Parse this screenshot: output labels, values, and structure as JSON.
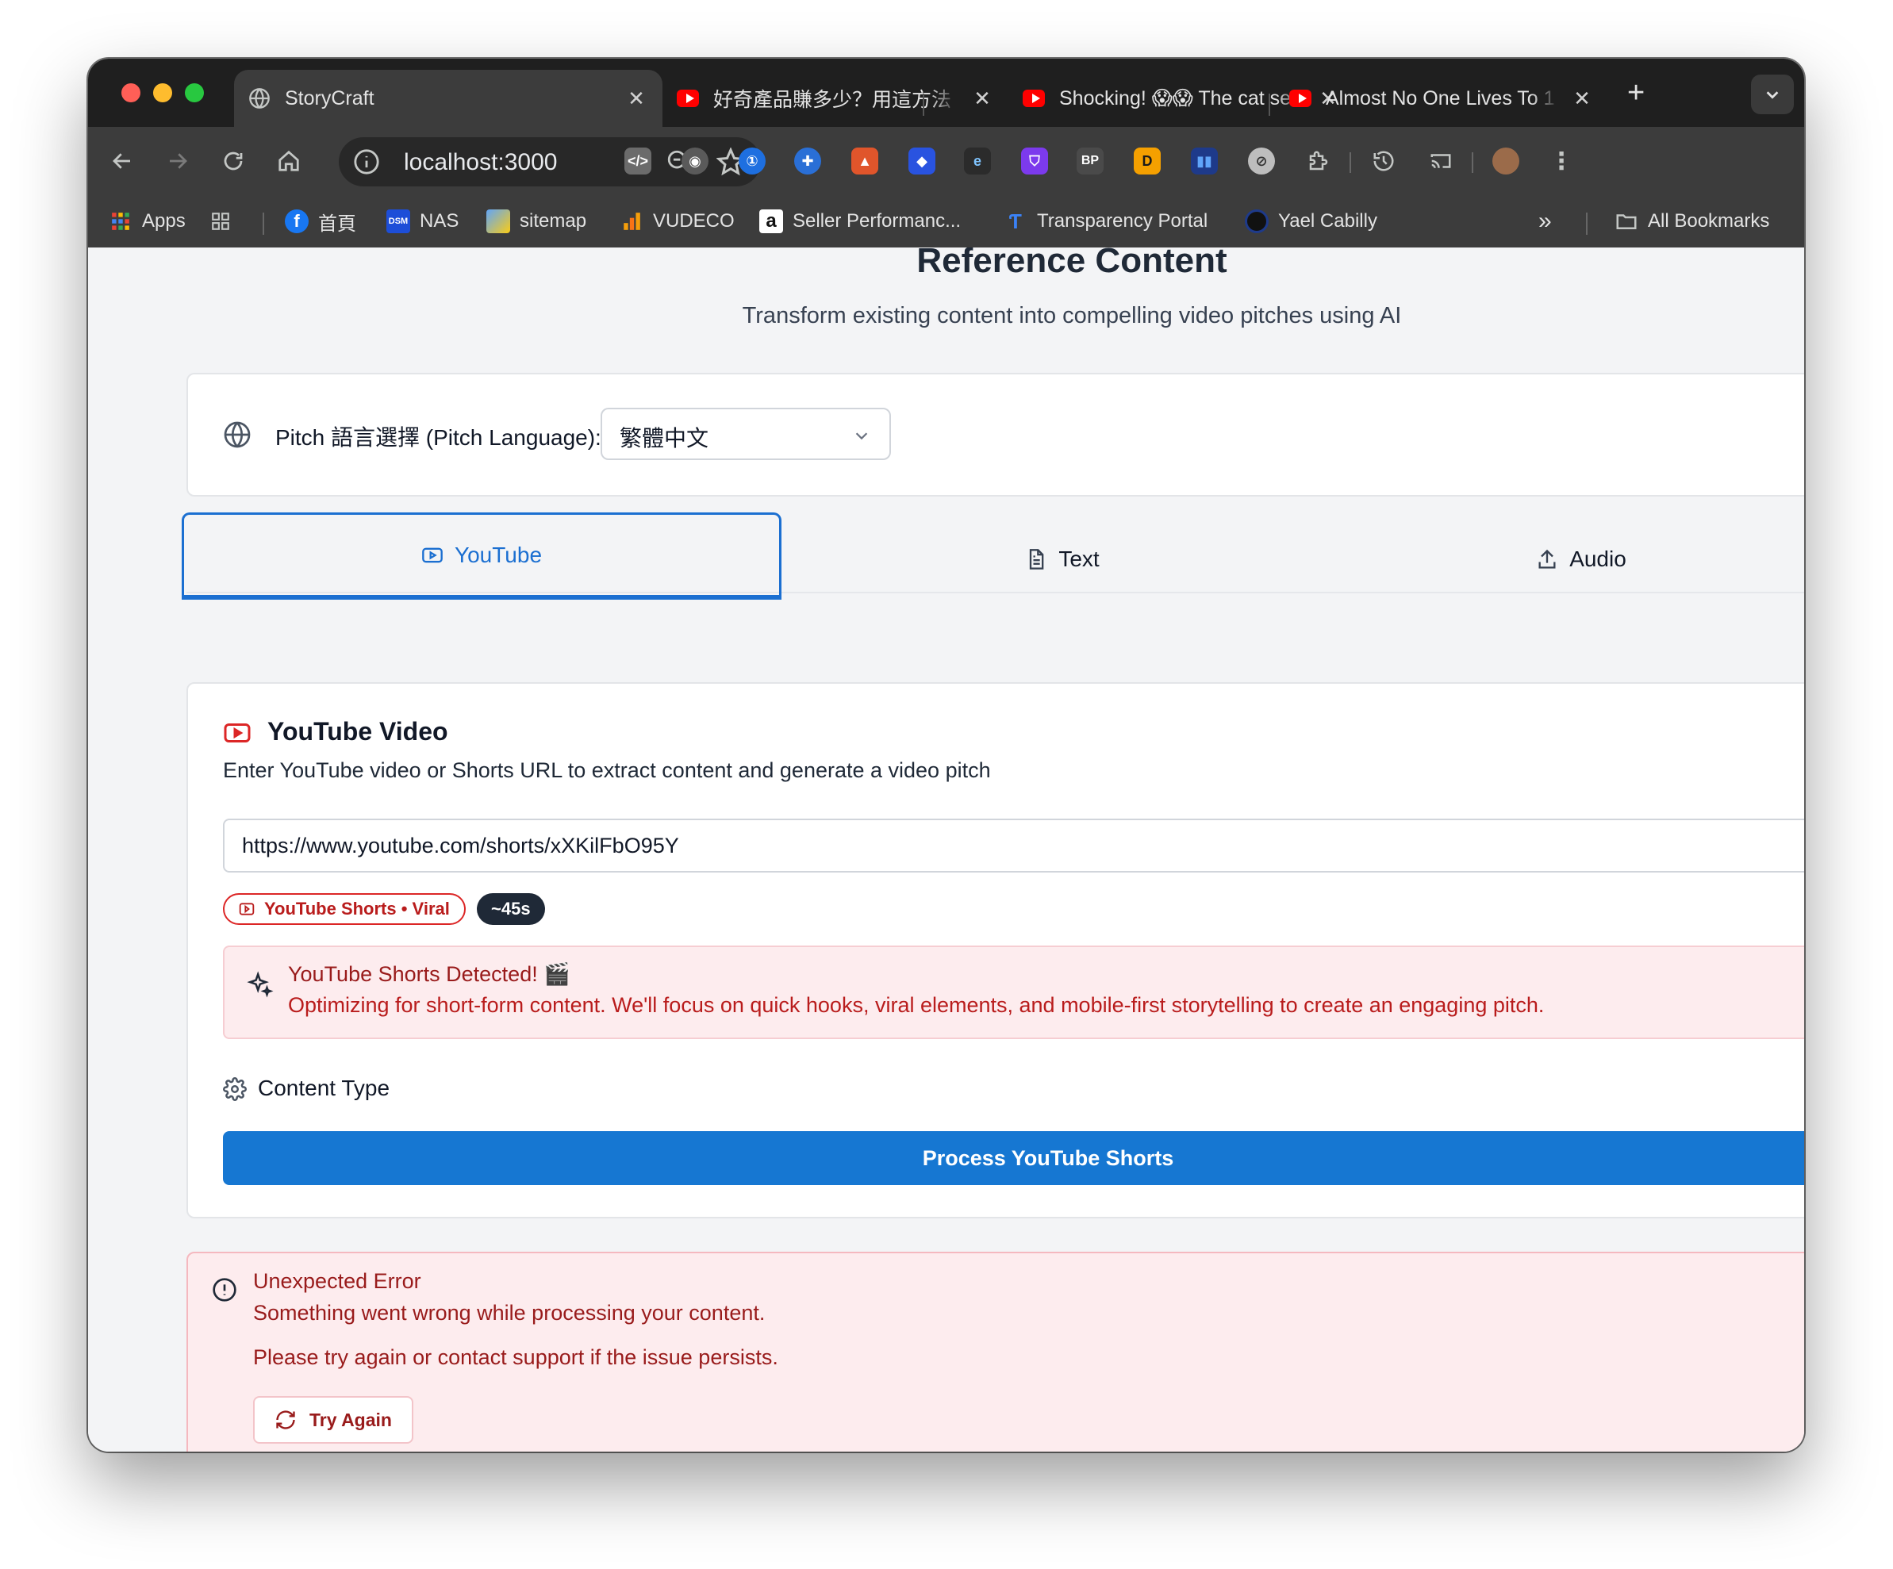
{
  "browser": {
    "tabs": [
      {
        "title": "StoryCraft",
        "favicon": "globe-icon",
        "active": true
      },
      {
        "title": "好奇產品賺多少？用這方法",
        "favicon": "youtube-icon",
        "active": false
      },
      {
        "title": "Shocking! 😱😱 The cat se",
        "favicon": "youtube-icon",
        "active": false
      },
      {
        "title": "Almost No One Lives To 1",
        "favicon": "youtube-icon",
        "active": false
      }
    ],
    "address": "localhost:3000",
    "bookmarks": [
      {
        "label": "Apps",
        "icon": "apps-grid-icon"
      },
      {
        "label": "",
        "icon": "tab-groups-icon"
      },
      {
        "label": "首頁",
        "icon": "facebook-icon"
      },
      {
        "label": "NAS",
        "icon": "dsm-icon"
      },
      {
        "label": "sitemap",
        "icon": "sitemap-icon"
      },
      {
        "label": "VUDECO",
        "icon": "analytics-icon"
      },
      {
        "label": "Seller Performanc...",
        "icon": "amazon-icon"
      },
      {
        "label": "Transparency Portal",
        "icon": "transparency-icon"
      },
      {
        "label": "Yael Cabilly",
        "icon": "circle-icon"
      }
    ],
    "all_bookmarks": "All Bookmarks"
  },
  "page": {
    "title": "Reference Content",
    "subtitle": "Transform existing content into compelling video pitches using AI",
    "language": {
      "label": "Pitch 語言選擇 (Pitch Language):",
      "selected": "繁體中文"
    },
    "tabs": [
      {
        "label": "YouTube",
        "icon": "youtube-outline-icon",
        "active": true
      },
      {
        "label": "Text",
        "icon": "file-text-icon",
        "active": false
      },
      {
        "label": "Audio",
        "icon": "upload-icon",
        "active": false
      }
    ],
    "youtube": {
      "title": "YouTube Video",
      "description": "Enter YouTube video or Shorts URL to extract content and generate a video pitch",
      "url_value": "https://www.youtube.com/shorts/xXKilFbO95Y",
      "badge_type": "YouTube Shorts • Viral",
      "badge_duration": "~45s",
      "alert_title": "YouTube Shorts Detected! 🎬",
      "alert_body": "Optimizing for short-form content. We'll focus on quick hooks, viral elements, and mobile-first storytelling to create an engaging pitch.",
      "content_type_label": "Content Type",
      "process_label": "Process YouTube Shorts"
    },
    "error": {
      "title": "Unexpected Error",
      "message": "Something went wrong while processing your content.",
      "help": "Please try again or contact support if the issue persists.",
      "retry_label": "Try Again"
    }
  },
  "colors": {
    "accent": "#1677d2",
    "tab_active": "#1b6fd1",
    "error_bg": "#fdecee",
    "error_text": "#991b1b",
    "badge_red": "#dc2626",
    "browser_dark": "#3c3c3c"
  }
}
